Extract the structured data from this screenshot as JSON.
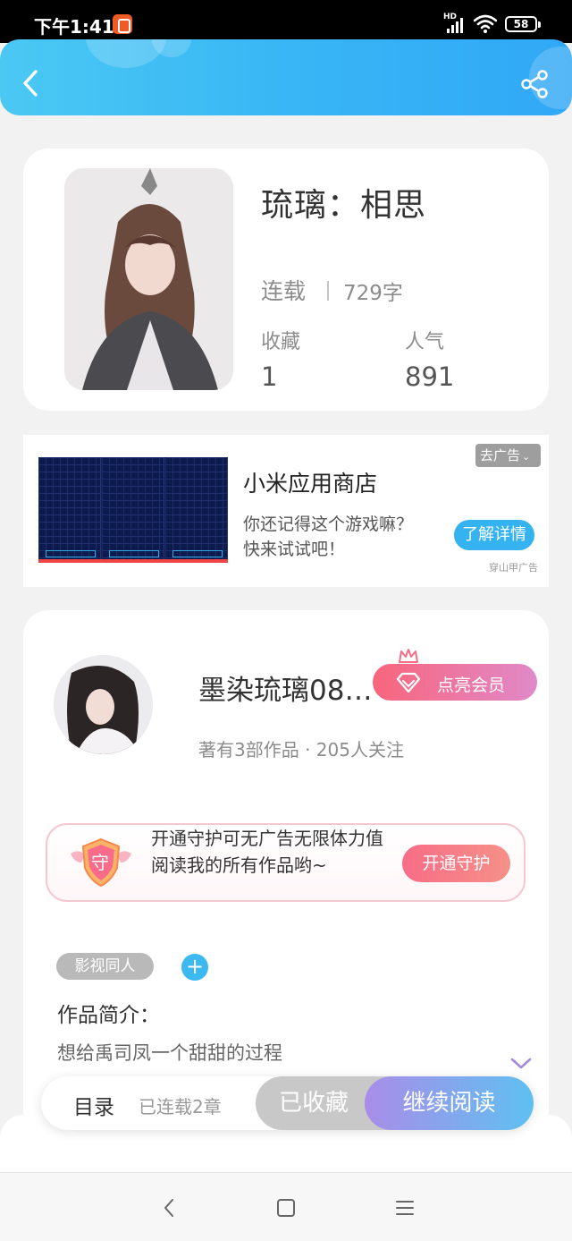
{
  "status_bar": {
    "time": "下午1:41",
    "network": "HD",
    "battery": "58"
  },
  "book": {
    "title": "琉璃：相思",
    "status": "连载",
    "words": "729字",
    "collect_label": "收藏",
    "collect_value": "1",
    "popularity_label": "人气",
    "popularity_value": "891"
  },
  "ad": {
    "title": "小米应用商店",
    "desc_line1": "你还记得这个游戏嘛？",
    "desc_line2": "快来试试吧！",
    "close_label": "去广告",
    "cta_label": "了解详情",
    "source": "穿山甲广告"
  },
  "author": {
    "name": "墨染琉璃08…",
    "meta": "著有3部作品 · 205人关注",
    "vip_label": "点亮会员",
    "guard_badge": "守",
    "guard_text": "开通守护可无广告无限体力值阅读我的所有作品哟~",
    "guard_button": "开通守护"
  },
  "tags": [
    "影视同人"
  ],
  "intro": {
    "title": "作品简介：",
    "text": "想给禹司凤一个甜甜的过程"
  },
  "bottom": {
    "toc_label": "目录",
    "chapters": "已连载2章",
    "fav_label": "已收藏",
    "read_label": "继续阅读"
  },
  "colors": {
    "header_blue": "#38b6f5",
    "accent_blue": "#35b2f0",
    "pink": "#f8657c",
    "purple": "#a98de8"
  },
  "icons": [
    "back-icon",
    "share-icon",
    "crown-icon",
    "diamond-icon",
    "shield-icon",
    "plus-icon",
    "chevron-down-icon",
    "nav-back-icon",
    "nav-home-icon",
    "nav-menu-icon"
  ]
}
